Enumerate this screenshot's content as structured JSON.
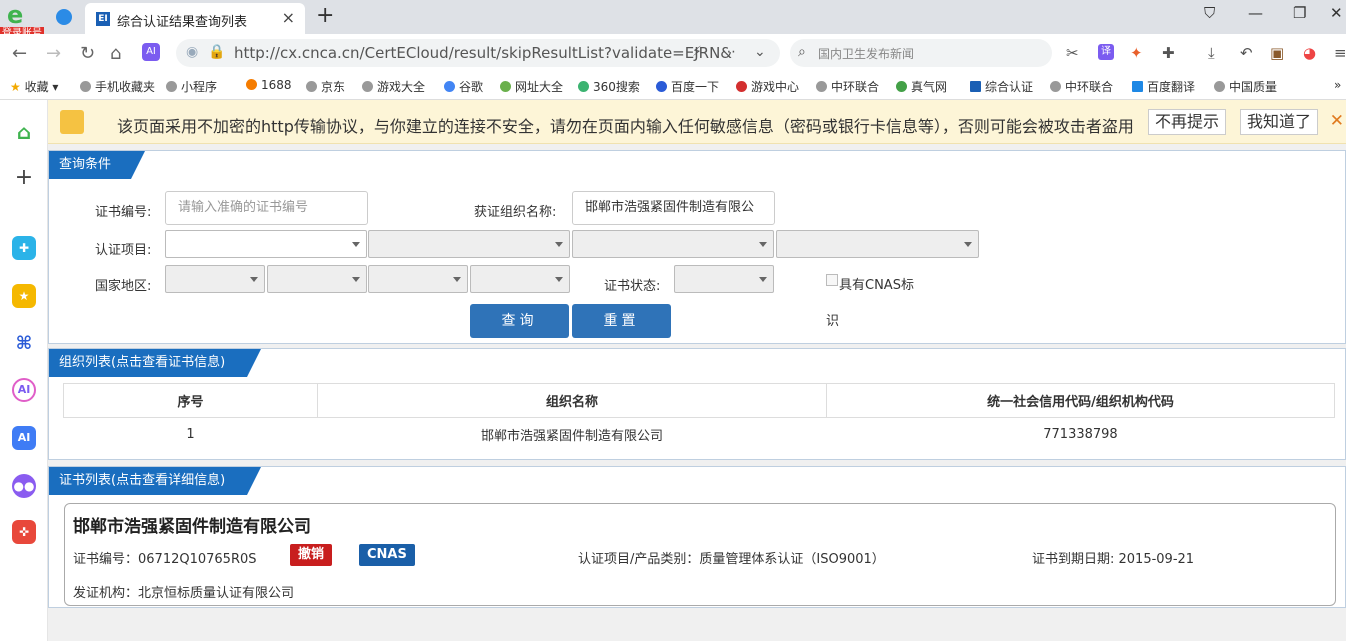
{
  "browser": {
    "login_badge": "登录账号",
    "tab_title": "综合认证结果查询列表",
    "tab_fav": "EI",
    "url": "http://cx.cnca.cn/CertECloud/result/skipResultList?validate=EJRN&",
    "search_placeholder": "国内卫生发布新闻"
  },
  "bookmarks": [
    "收藏",
    "手机收藏夹",
    "小程序",
    "1688",
    "京东",
    "游戏大全",
    "谷歌",
    "网址大全",
    "360搜索",
    "百度一下",
    "游戏中心",
    "中环联合",
    "真气网",
    "综合认证",
    "中环联合",
    "百度翻译",
    "中国质量"
  ],
  "sidebar_ai_label": "AI",
  "warning": {
    "text": "该页面采用不加密的http传输协议，与你建立的连接不安全，请勿在页面内输入任何敏感信息（密码或银行卡信息等），否则可能会被攻击者盗用",
    "dismiss_label": "不再提示",
    "ok_label": "我知道了"
  },
  "query": {
    "section_title": "查询条件",
    "cert_no_label": "证书编号:",
    "cert_no_placeholder": "请输入准确的证书编号",
    "org_label": "获证组织名称:",
    "org_value": "邯郸市浩强紧固件制造有限公",
    "project_label": "认证项目:",
    "region_label": "国家地区:",
    "status_label": "证书状态:",
    "cnas_label_1": "具有CNAS标",
    "cnas_label_2": "识",
    "search_button": "查询",
    "reset_button": "重置"
  },
  "org_list": {
    "section_title": "组织列表(点击查看证书信息)",
    "headers": [
      "序号",
      "组织名称",
      "统一社会信用代码/组织机构代码"
    ],
    "rows": [
      [
        "1",
        "邯郸市浩强紧固件制造有限公司",
        "771338798"
      ]
    ]
  },
  "cert_list": {
    "section_title": "证书列表(点击查看详细信息)",
    "company": "邯郸市浩强紧固件制造有限公司",
    "cert_no": "证书编号：06712Q10765R0S",
    "revoked_badge": "撤销",
    "cnas_badge": "CNAS",
    "project": "认证项目/产品类别：质量管理体系认证（ISO9001）",
    "expiry": "证书到期日期: 2015-09-21",
    "issuer": "发证机构：北京恒标质量认证有限公司"
  },
  "colors": {
    "accent": "#1a6ebf",
    "button": "#2f73b8",
    "revoked": "#c81e1e",
    "cnas": "#1a5fa8"
  }
}
